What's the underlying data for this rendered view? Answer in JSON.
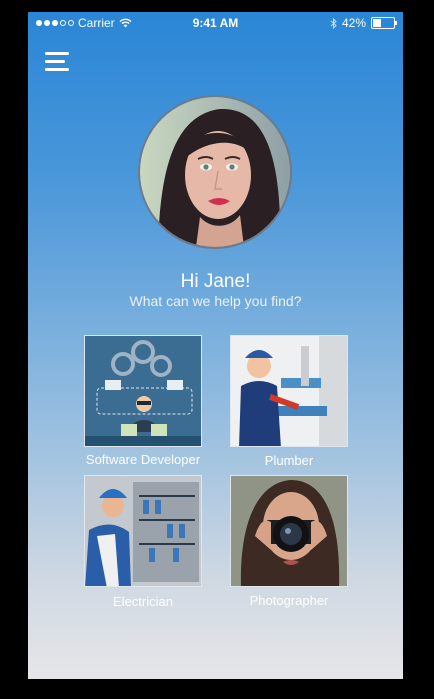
{
  "status_bar": {
    "carrier": "Carrier",
    "time": "9:41 AM",
    "battery": "42%",
    "battery_level": 0.42
  },
  "header": {
    "menu_icon": "hamburger-menu-icon"
  },
  "profile": {
    "greeting": "Hi Jane!",
    "prompt": "What can we help you find?"
  },
  "categories": [
    {
      "label": "Software Developer",
      "icon": "software-developer-image"
    },
    {
      "label": "Plumber",
      "icon": "plumber-image"
    },
    {
      "label": "Electrician",
      "icon": "electrician-image"
    },
    {
      "label": "Photographer",
      "icon": "photographer-image"
    }
  ],
  "colors": {
    "gradient_top": "#2a86d6",
    "gradient_bottom": "#e6e6e9",
    "text": "#ffffff"
  }
}
